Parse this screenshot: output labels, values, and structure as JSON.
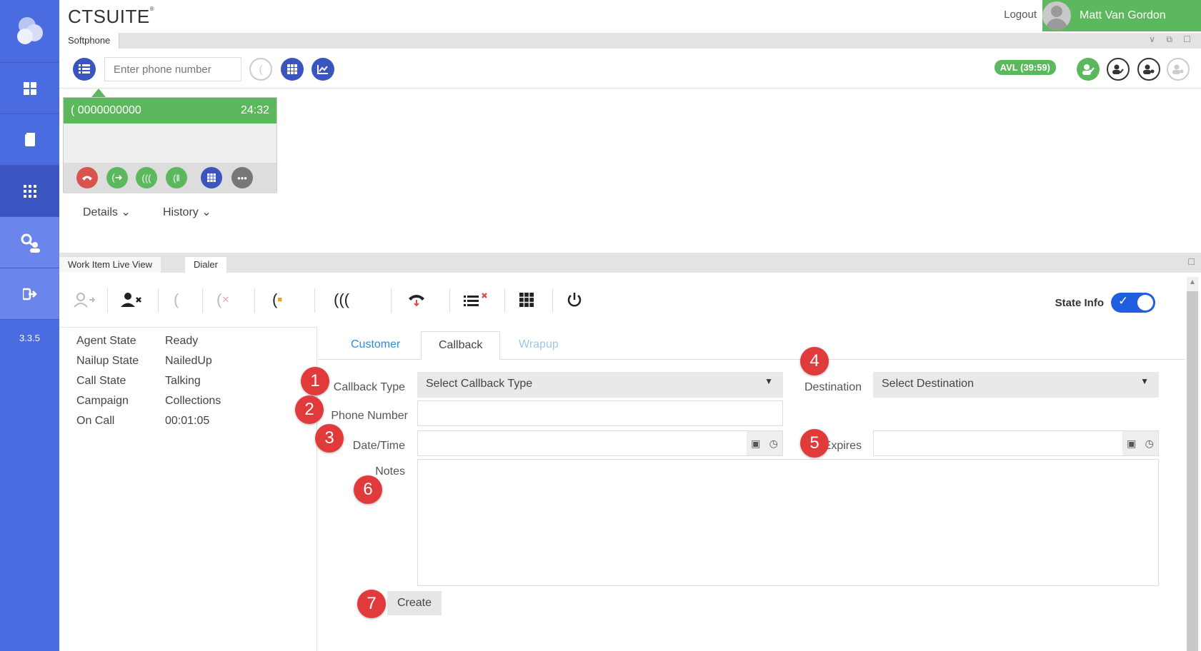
{
  "app": {
    "brand": "CTSUITE",
    "brand_mark": "®",
    "version": "3.3.5"
  },
  "header": {
    "logout": "Logout",
    "user_name": "Matt Van Gordon"
  },
  "softphone": {
    "tab": "Softphone",
    "phone_placeholder": "Enter phone number",
    "avl_badge": "AVL (39:59)"
  },
  "call": {
    "number": "0000000000",
    "timer": "24:32"
  },
  "call_links": {
    "details": "Details",
    "history": "History"
  },
  "lower_tabs": [
    {
      "label": "Work Item Live View"
    },
    {
      "label": "Dialer"
    }
  ],
  "state_info": {
    "label": "State Info",
    "enabled": true
  },
  "state_list": [
    {
      "key": "Agent State",
      "value": "Ready"
    },
    {
      "key": "Nailup State",
      "value": "NailedUp"
    },
    {
      "key": "Call State",
      "value": "Talking"
    },
    {
      "key": "Campaign",
      "value": "Collections"
    },
    {
      "key": "On Call",
      "value": "00:01:05"
    }
  ],
  "form_tabs": [
    {
      "label": "Customer"
    },
    {
      "label": "Callback"
    },
    {
      "label": "Wrapup"
    }
  ],
  "form": {
    "callback_type_label": "Callback Type",
    "callback_type_value": "Select Callback Type",
    "destination_label": "Destination",
    "destination_value": "Select Destination",
    "phone_number_label": "Phone Number",
    "datetime_label": "Date/Time",
    "expires_label": "Expires",
    "notes_label": "Notes",
    "create_button": "Create"
  },
  "markers": [
    "1",
    "2",
    "3",
    "4",
    "5",
    "6",
    "7"
  ],
  "colors": {
    "sidebar": "#4b6be0",
    "accent_green": "#5cb85c",
    "accent_blue": "#3a55bf",
    "marker_red": "#e03a3a"
  }
}
